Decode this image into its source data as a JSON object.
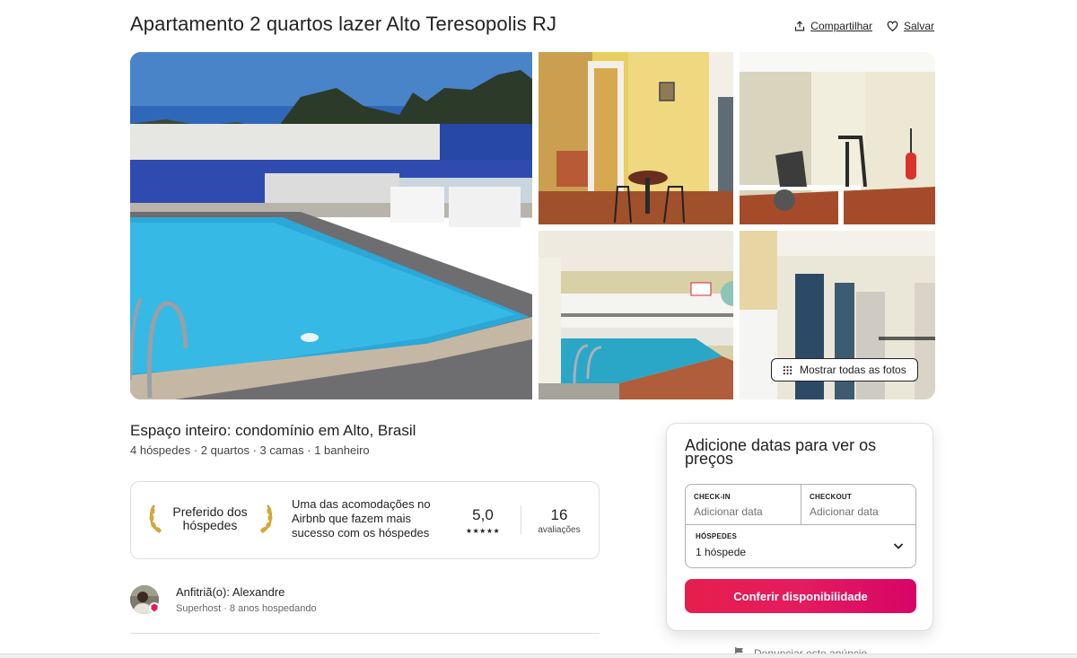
{
  "listing": {
    "title": "Apartamento 2 quartos lazer Alto Teresopolis RJ",
    "share_label": "Compartilhar",
    "save_label": "Salvar"
  },
  "gallery": {
    "show_all_label": "Mostrar todas as fotos"
  },
  "overview": {
    "subtitle": "Espaço inteiro: condomínio em Alto, Brasil",
    "details": "4 hóspedes · 2 quartos · 3 camas · 1 banheiro"
  },
  "guest_favorite": {
    "title": "Preferido dos hóspedes",
    "description": "Uma das acomodações no Airbnb que fazem mais sucesso com os hóspedes",
    "rating": "5,0",
    "stars": "★★★★★",
    "reviews_count": "16",
    "reviews_label": "avaliações"
  },
  "host": {
    "name_line": "Anfitriã(o): Alexandre",
    "meta": "Superhost · 8 anos hospedando"
  },
  "booking": {
    "title": "Adicione datas para ver os preços",
    "checkin_label": "CHECK-IN",
    "checkin_placeholder": "Adicionar data",
    "checkout_label": "CHECKOUT",
    "checkout_placeholder": "Adicionar data",
    "guests_label": "HÓSPEDES",
    "guests_value": "1 hóspede",
    "cta_label": "Conferir disponibilidade",
    "accent_color": "#e31c5f"
  },
  "footer": {
    "report_label": "Denunciar este anúncio"
  },
  "icons": [
    "share-icon",
    "heart-icon",
    "grid-dots-icon",
    "laurel-left-icon",
    "laurel-right-icon",
    "chevron-down-icon",
    "flag-icon",
    "superhost-badge-icon"
  ]
}
